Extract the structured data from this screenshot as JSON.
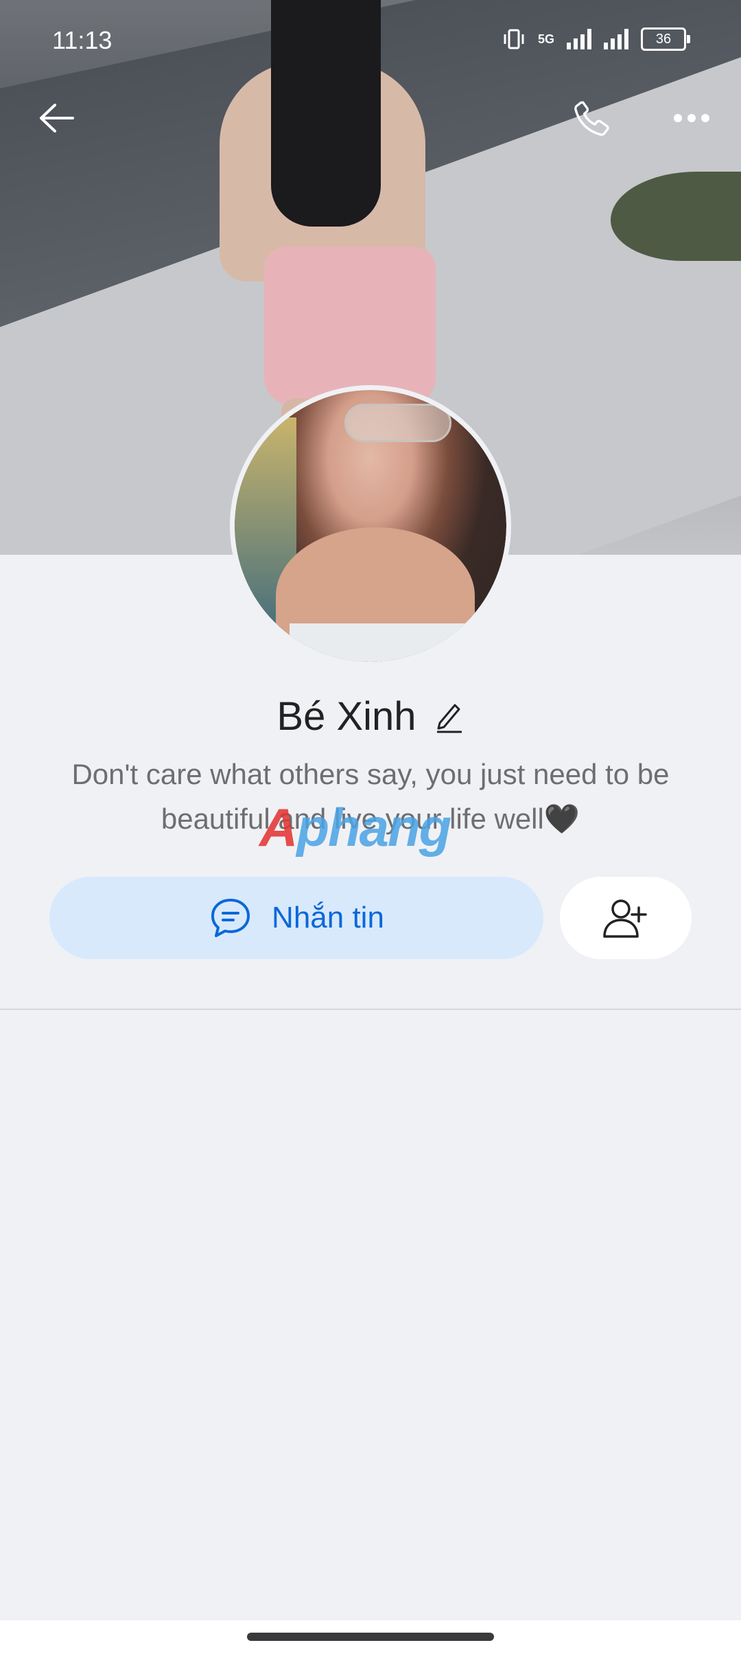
{
  "status_bar": {
    "time": "11:13",
    "network": "5G",
    "battery": "36"
  },
  "nav": {
    "back_icon": "back-arrow-icon",
    "call_icon": "phone-icon",
    "more_icon": "more-horizontal-icon"
  },
  "profile": {
    "name": "Bé Xinh",
    "bio": "Don't care what others say, you just need to be beautiful and live your life well🖤"
  },
  "actions": {
    "message_label": "Nhắn tin",
    "message_icon": "chat-bubble-icon",
    "add_friend_icon": "add-friend-icon"
  },
  "watermark": {
    "text_a": "A",
    "text_rest": "phang"
  },
  "colors": {
    "accent": "#0a68d8",
    "message_button_bg": "#d8e9fc",
    "page_bg": "#f0f1f5"
  }
}
